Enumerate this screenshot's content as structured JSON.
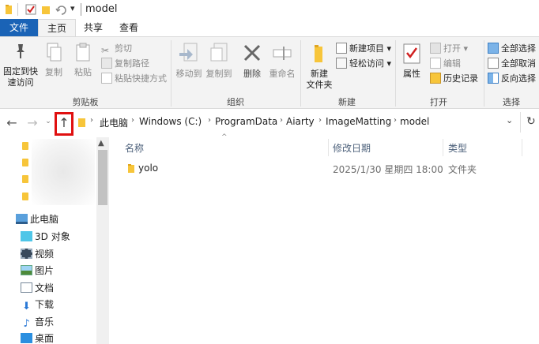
{
  "window": {
    "title": "model",
    "quick_access_dropdown": "▾"
  },
  "ribbon_tabs": [
    "文件",
    "主页",
    "共享",
    "查看"
  ],
  "ribbon": {
    "clipboard": {
      "pin_label_1": "固定到快",
      "pin_label_2": "速访问",
      "copy": "复制",
      "paste": "粘贴",
      "cut": "剪切",
      "copy_path": "复制路径",
      "paste_shortcut": "粘贴快捷方式",
      "group": "剪贴板"
    },
    "organize": {
      "move_to": "移动到",
      "copy_to": "复制到",
      "delete": "删除",
      "rename": "重命名",
      "group": "组织"
    },
    "new": {
      "new_folder_1": "新建",
      "new_folder_2": "文件夹",
      "new_item": "新建项目",
      "easy_access": "轻松访问",
      "group": "新建"
    },
    "open": {
      "properties": "属性",
      "open": "打开",
      "edit": "编辑",
      "history": "历史记录",
      "group": "打开"
    },
    "select": {
      "select_all": "全部选择",
      "select_none": "全部取消",
      "invert": "反向选择",
      "group": "选择"
    }
  },
  "address": {
    "crumbs": [
      "此电脑",
      "Windows (C:)",
      "ProgramData",
      "Aiarty",
      "ImageMatting",
      "model"
    ]
  },
  "nav_pane": {
    "items": [
      "此电脑",
      "3D 对象",
      "视频",
      "图片",
      "文档",
      "下载",
      "音乐",
      "桌面"
    ]
  },
  "file_list": {
    "columns": [
      "名称",
      "修改日期",
      "类型"
    ],
    "rows": [
      {
        "name": "yolo",
        "modified": "2025/1/30 星期四 18:00",
        "type": "文件夹"
      }
    ]
  },
  "colors": {
    "accent": "#1a63b6",
    "folder": "#f7c53a",
    "highlight": "#e01010"
  }
}
